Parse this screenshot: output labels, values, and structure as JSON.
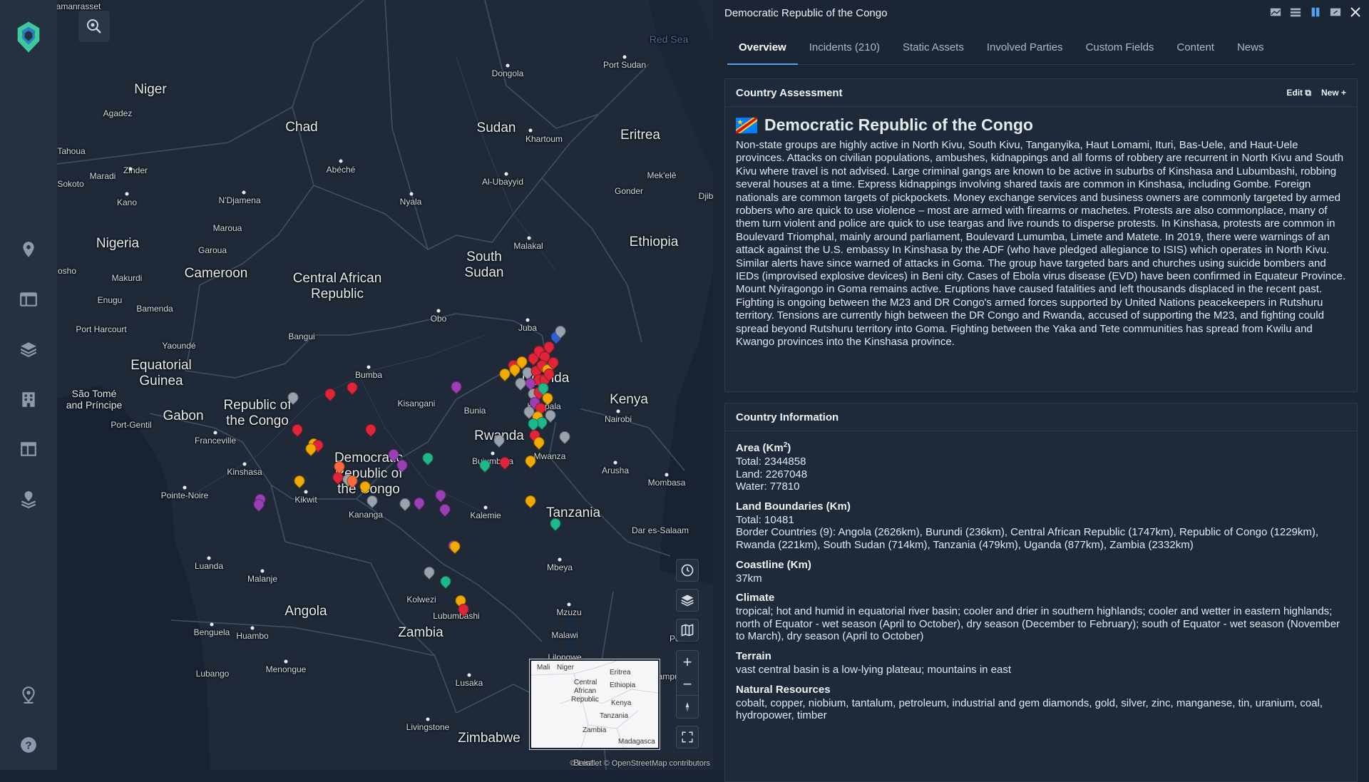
{
  "panel": {
    "title": "Democratic Republic of the Congo",
    "tabs": [
      {
        "label": "Overview"
      },
      {
        "label": "Incidents (210)"
      },
      {
        "label": "Static Assets"
      },
      {
        "label": "Involved Parties"
      },
      {
        "label": "Custom Fields"
      },
      {
        "label": "Content"
      },
      {
        "label": "News"
      }
    ],
    "assessment": {
      "header": "Country Assessment",
      "edit_label": "Edit",
      "new_label": "New",
      "country_name": "Democratic Republic of the Congo",
      "text": "Non-state groups are highly active in North Kivu, South Kivu, Tanganyika, Haut Lomami, Ituri, Bas-Uele, and Haut-Uele provinces. Attacks on civilian populations, ambushes, kidnappings and all forms of robbery are recurrent in North Kivu and South Kivu where travel is not advised. Large criminal gangs are known to be active in suburbs of Kinshasa and Lubumbashi, robbing several houses at a time. Express kidnappings involving shared taxis are common in Kinshasa, including Gombe. Foreign nationals are common targets of pickpockets. Money exchange services and business owners are commonly targeted by armed robbers who are quick to use violence – most are armed with firearms or machetes. Protests are also commonplace, many of them turn violent and police are quick to use teargas and live rounds to disperse protests. In Kinshasa, protests are common in Boulevard Triomphal, mainly around parliament, Boulevard Lumumba, Limete and Matete. In 2019, there were warnings of an attack against the U.S. embassy In Kinshasa by the ADF (who have pledged allegiance to ISIS) which operates in North Kivu. Similar alerts have since warned of attacks in Goma. The group have targeted bars and churches using suicide bombers and IEDs (improvised explosive devices) in Beni city. Cases of Ebola virus disease (EVD) have been confirmed in Equateur Province. Mount Nyiragongo in Goma remains active. Eruptions have caused fatalities and left thousands displaced in the recent past. Fighting is ongoing between the M23 and DR Congo's armed forces supported by United Nations peacekeepers in Rutshuru territory. Tensions are currently high between the DR Congo and Rwanda, accused of supporting the M23, and fighting could spread beyond Rutshuru territory into Goma. Fighting between the Yaka and Tete communities has spread from Kwilu and Kwango provinces into the Kinshasa province."
    },
    "info": {
      "header": "Country Information",
      "area_title_prefix": "Area (Km",
      "area_title_sup": "2",
      "area_title_suffix": ")",
      "area_total": "Total: 2344858",
      "area_land": "Land: 2267048",
      "area_water": "Water: 77810",
      "boundaries_title": "Land Boundaries (Km)",
      "boundaries_total": "Total: 10481",
      "boundaries_countries": "Border Countries (9): Angola (2626km), Burundi (236km), Central African Republic (1747km), Republic of Congo (1229km), Rwanda (221km), South Sudan (714km), Tanzania (479km), Uganda (877km), Zambia (2332km)",
      "coastline_title": "Coastline (Km)",
      "coastline_value": "37km",
      "climate_title": "Climate",
      "climate_value": "tropical; hot and humid in equatorial river basin; cooler and drier in southern highlands; cooler and wetter in eastern highlands; north of Equator - wet season (April to October), dry season (December to February); south of Equator - wet season (November to March), dry season (April to October)",
      "terrain_title": "Terrain",
      "terrain_value": "vast central basin is a low-lying plateau; mountains in east",
      "resources_title": "Natural Resources",
      "resources_value": "cobalt, copper, niobium, tantalum, petroleum, industrial and gem diamonds, gold, silver, zinc, manganese, tin, uranium, coal, hydropower, timber"
    }
  },
  "map": {
    "countries": [
      {
        "name": "Niger"
      },
      {
        "name": "Chad"
      },
      {
        "name": "Sudan"
      },
      {
        "name": "Eritrea"
      },
      {
        "name": "Nigeria"
      },
      {
        "name": "Ethiopia"
      },
      {
        "name": "South\nSudan"
      },
      {
        "name": "Cameroon"
      },
      {
        "name": "Central African\nRepublic"
      },
      {
        "name": "Equatorial\nGuinea"
      },
      {
        "name": "Uganda"
      },
      {
        "name": "Kenya"
      },
      {
        "name": "Gabon"
      },
      {
        "name": "Republic of\nthe Congo"
      },
      {
        "name": "Rwanda"
      },
      {
        "name": "Democratic\nRepublic of\nthe Congo"
      },
      {
        "name": "Tanzania"
      },
      {
        "name": "Angola"
      },
      {
        "name": "Zambia"
      },
      {
        "name": "Zimbabwe"
      },
      {
        "name": "São Tomé\nand Príncipe"
      }
    ],
    "sea": "Red Sea",
    "cities": [
      "amanrasset",
      "Agadez",
      "Tahoua",
      "Maradi",
      "Zinder",
      "Sokoto",
      "Kano",
      "N'Djamena",
      "Abéché",
      "Dongola",
      "Port Sudan",
      "Khartoum",
      "Al-Ubayyid",
      "Nyala",
      "Gonder",
      "Mek'elē",
      "Maroua",
      "Garoua",
      "Malakal",
      "osho",
      "Makurdi",
      "Enugu",
      "Bamenda",
      "Port Harcourt",
      "Yaoundé",
      "Bangui",
      "Obo",
      "Juba",
      "Bumba",
      "Kisangani",
      "Kampala",
      "Nairobi",
      "Bunia",
      "Port-Gentil",
      "Franceville",
      "Kinshasa",
      "Kikwit",
      "Kananga",
      "Bujumbura",
      "Mwanza",
      "Arusha",
      "Mombasa",
      "Pointe-Noire",
      "Kalemie",
      "Dar es-Salaam",
      "Luanda",
      "Malanje",
      "Mbeya",
      "Kolwezi",
      "Lubumbashi",
      "Mzuzu",
      "Malawi",
      "Lilongwe",
      "Benguela",
      "Huambo",
      "Lubango",
      "Menongue",
      "Lusaka",
      "Livingstone",
      "Beira",
      "Djib",
      "Pemba",
      "Nampula"
    ],
    "minimap_labels": [
      "Mali",
      "Niger",
      "Eritrea",
      "Central",
      "African",
      "Republic",
      "Ethiopia",
      "Kenya",
      "Tanzania",
      "Zambia",
      "Madagasca"
    ],
    "attribution": "© Leaflet © OpenStreetMap contributors",
    "zoom_in": "+",
    "zoom_out": "−",
    "pins": [
      {
        "color": "#f2a900"
      },
      {
        "color": "#e0253a"
      },
      {
        "color": "#9b3fb5"
      },
      {
        "color": "#9aa3ad"
      },
      {
        "color": "#1fb88a"
      },
      {
        "color": "#2f5fd0"
      },
      {
        "color": "#ff6a3d"
      }
    ]
  },
  "icons": {
    "logo": "logo-icon",
    "location": "map-pin-icon",
    "table": "table-icon",
    "layers": "layers-icon",
    "buildings": "buildings-icon",
    "dashboard": "dashboard-icon",
    "stack-pin": "stacked-pin-icon",
    "place": "place-icon",
    "help": "help-icon"
  }
}
